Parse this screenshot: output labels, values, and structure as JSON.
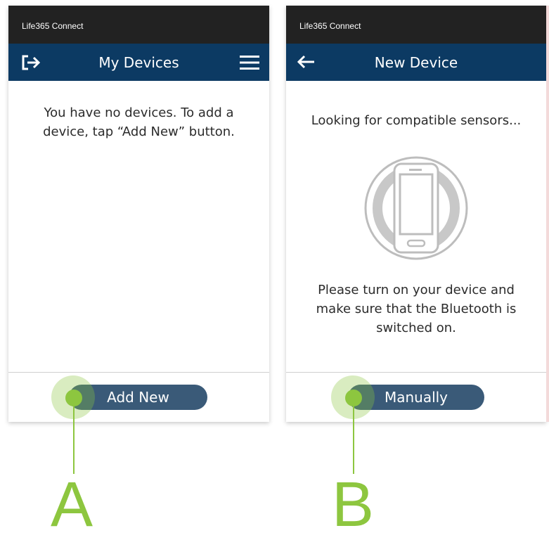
{
  "screen_a": {
    "status_bar": "Life365 Connect",
    "nav_title": "My Devices",
    "message": "You have no devices. To add a device, tap “Add New” button.",
    "button_label": "Add New"
  },
  "screen_b": {
    "status_bar": "Life365 Connect",
    "nav_title": "New Device",
    "heading": "Looking for compatible sensors...",
    "instructions": "Please turn on your device and make sure that the Bluetooth is switched on.",
    "button_label": "Manually"
  },
  "callouts": {
    "a": "A",
    "b": "B"
  },
  "icons": {
    "logout": "logout-icon",
    "menu": "hamburger-menu-icon",
    "back": "back-arrow-icon",
    "phone": "phone-search-icon"
  },
  "colors": {
    "status_bar": "#222222",
    "nav_bar": "#0c3a63",
    "button": "#3a5a78",
    "callout": "#8dc63f"
  }
}
